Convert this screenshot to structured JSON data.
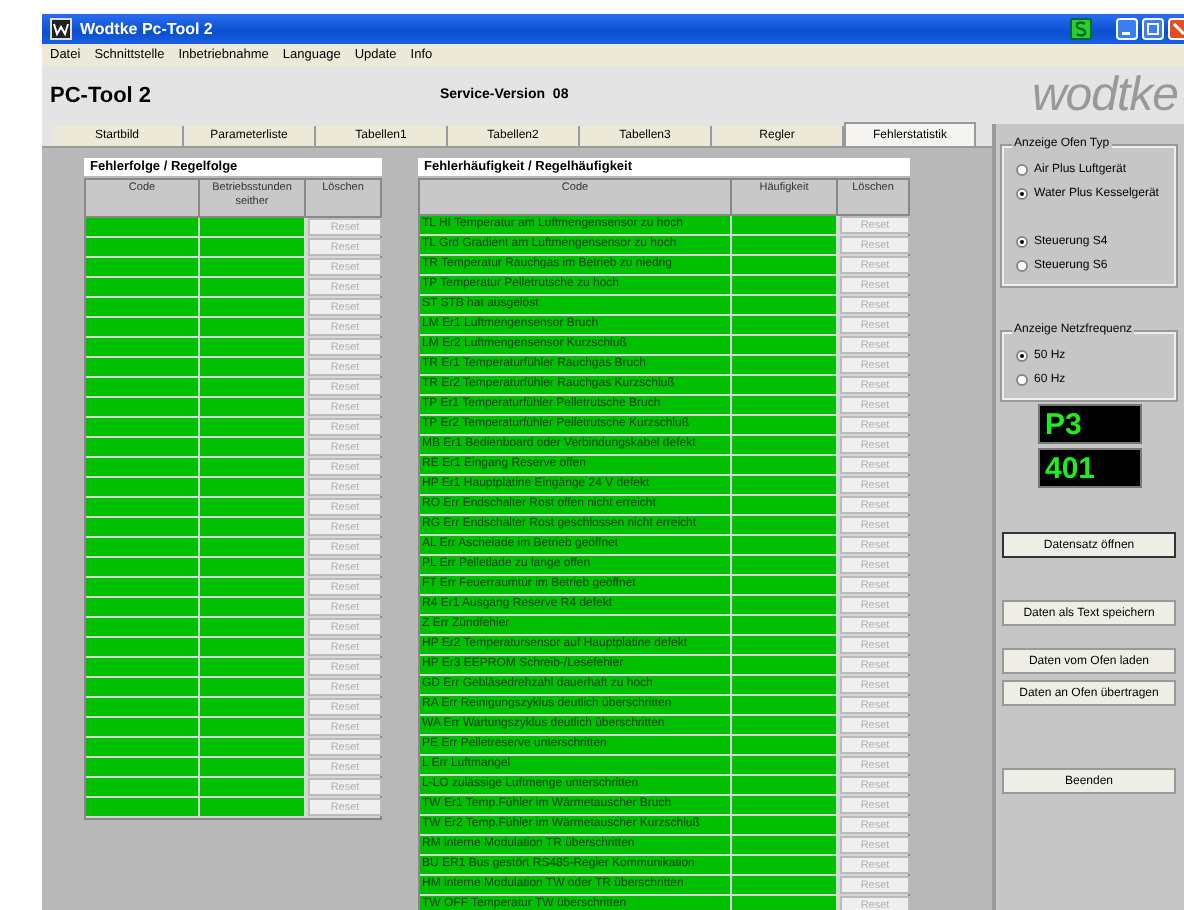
{
  "window": {
    "title": "Wodtke Pc-Tool 2"
  },
  "menu": [
    "Datei",
    "Schnittstelle",
    "Inbetriebnahme",
    "Language",
    "Update",
    "Info"
  ],
  "header": {
    "app_name": "PC-Tool 2",
    "version": "Service-Version  08",
    "logo": "wodtke"
  },
  "tabs": [
    {
      "label": "Startbild",
      "selected": false
    },
    {
      "label": "Parameterliste",
      "selected": false
    },
    {
      "label": "Tabellen1",
      "selected": false
    },
    {
      "label": "Tabellen2",
      "selected": false
    },
    {
      "label": "Tabellen3",
      "selected": false
    },
    {
      "label": "Regler",
      "selected": false
    },
    {
      "label": "Fehlerstatistik",
      "selected": true
    }
  ],
  "error_sequence": {
    "title": "Fehlerfolge / Regelfolge",
    "columns": [
      "Code",
      "Betriebsstunden seither",
      "Löschen"
    ],
    "rows": [
      {
        "reset": "Reset",
        "disabled": true
      },
      {
        "reset": "Reset",
        "disabled": true
      },
      {
        "reset": "Reset",
        "disabled": true
      },
      {
        "reset": "Reset",
        "disabled": true
      },
      {
        "reset": "Reset",
        "disabled": true
      },
      {
        "reset": "Reset",
        "disabled": true
      },
      {
        "reset": "Reset",
        "disabled": true
      },
      {
        "reset": "Reset",
        "disabled": true
      },
      {
        "reset": "Reset",
        "disabled": true
      },
      {
        "reset": "Reset",
        "disabled": true
      },
      {
        "reset": "Reset",
        "disabled": true
      },
      {
        "reset": "Reset",
        "disabled": true
      },
      {
        "reset": "Reset",
        "disabled": true
      },
      {
        "reset": "Reset",
        "disabled": true
      },
      {
        "reset": "Reset",
        "disabled": true
      },
      {
        "reset": "Reset",
        "disabled": true
      },
      {
        "reset": "Reset",
        "disabled": true
      },
      {
        "reset": "Reset",
        "disabled": true
      },
      {
        "reset": "Reset",
        "disabled": true
      },
      {
        "reset": "Reset",
        "disabled": true
      },
      {
        "reset": "Reset",
        "disabled": true
      },
      {
        "reset": "Reset",
        "disabled": true
      },
      {
        "reset": "Reset",
        "disabled": true
      },
      {
        "reset": "Reset",
        "disabled": true
      },
      {
        "reset": "Reset",
        "disabled": true
      },
      {
        "reset": "Reset",
        "disabled": true
      },
      {
        "reset": "Reset",
        "disabled": true
      },
      {
        "reset": "Reset",
        "disabled": true
      },
      {
        "reset": "Reset",
        "disabled": true
      },
      {
        "reset": "Reset",
        "disabled": true
      }
    ]
  },
  "error_frequency": {
    "title": "Fehlerhäufigkeit / Regelhäufigkeit",
    "columns": [
      "Code",
      "Häufigkeit",
      "Löschen"
    ],
    "rows": [
      {
        "code": "TL HI Temperatur am Luftmengensensor zu hoch",
        "reset": "Reset",
        "disabled": true
      },
      {
        "code": "TL Grd Gradient am Luftmengensensor zu hoch",
        "reset": "Reset",
        "disabled": true
      },
      {
        "code": "TR Temperatur Rauchgas im Betrieb zu niedrig",
        "reset": "Reset",
        "disabled": true
      },
      {
        "code": "TP Temperatur Pelletrutsche zu hoch",
        "reset": "Reset",
        "disabled": true
      },
      {
        "code": "ST STB hat ausgelöst",
        "reset": "Reset",
        "disabled": true
      },
      {
        "code": "LM Er1 Luftmengensensor Bruch",
        "reset": "Reset",
        "disabled": true
      },
      {
        "code": "LM Er2 Luftmengensensor Kurzschluß",
        "reset": "Reset",
        "disabled": true
      },
      {
        "code": "TR Er1 Temperaturfühler Rauchgas Bruch",
        "reset": "Reset",
        "disabled": true
      },
      {
        "code": "TR Er2 Temperaturfühler Rauchgas Kurzschluß",
        "reset": "Reset",
        "disabled": true
      },
      {
        "code": "TP Er1 Temperaturfühler Pelletrutsche Bruch",
        "reset": "Reset",
        "disabled": true
      },
      {
        "code": "TP Er2 Temperaturfühler Pelletrutsche Kurzschluß",
        "reset": "Reset",
        "disabled": true
      },
      {
        "code": "MB Er1 Bedienboard oder Verbindungskabel defekt",
        "reset": "Reset",
        "disabled": true
      },
      {
        "code": "RE Er1 Eingang Reserve offen",
        "reset": "Reset",
        "disabled": true
      },
      {
        "code": "HP Er1 Hauptplatine Eingänge 24 V defekt",
        "reset": "Reset",
        "disabled": true
      },
      {
        "code": "RO Err Endschalter Rost offen nicht erreicht",
        "reset": "Reset",
        "disabled": true
      },
      {
        "code": "RG Err Endschalter Rost geschlossen nicht erreicht",
        "reset": "Reset",
        "disabled": true
      },
      {
        "code": "AL Err Aschelade im Betrieb geöffnet",
        "reset": "Reset",
        "disabled": true
      },
      {
        "code": "PL Err Pelletlade zu lange offen",
        "reset": "Reset",
        "disabled": true
      },
      {
        "code": "FT Err Feuerraumtür im Betrieb geöffnet",
        "reset": "Reset",
        "disabled": true
      },
      {
        "code": "R4 Er1 Ausgang Reserve R4 defekt",
        "reset": "Reset",
        "disabled": true
      },
      {
        "code": "Z Err Zündfehler",
        "reset": "Reset",
        "disabled": true
      },
      {
        "code": "HP Er2 Temperatursensor auf Hauptplatine defekt",
        "reset": "Reset",
        "disabled": true
      },
      {
        "code": "HP Er3 EEPROM Schreib-/Lesefehler",
        "reset": "Reset",
        "disabled": true
      },
      {
        "code": "GD Err Gebläsedrehzahl dauerhaft zu hoch",
        "reset": "Reset",
        "disabled": true
      },
      {
        "code": "RA Err Reinigungszyklus deutlich überschritten",
        "reset": "Reset",
        "disabled": true
      },
      {
        "code": "WA Err Wartungszyklus deutlich überschritten",
        "reset": "Reset",
        "disabled": true
      },
      {
        "code": "PE Err Pelletreserve unterschritten",
        "reset": "Reset",
        "disabled": true
      },
      {
        "code": "L Err Luftmangel",
        "reset": "Reset",
        "disabled": true
      },
      {
        "code": "L-LO zulässige Luftmenge unterschritten",
        "reset": "Reset",
        "disabled": true
      },
      {
        "code": "TW Er1 Temp.Fühler im Wärmetauscher Bruch",
        "reset": "Reset",
        "disabled": true
      },
      {
        "code": "TW Er2 Temp.Fühler im Wärmetauscher Kurzschluß",
        "reset": "Reset",
        "disabled": true
      },
      {
        "code": "RM interne Modulation TR überschritten",
        "reset": "Reset",
        "disabled": true
      },
      {
        "code": "BU ER1 Bus gestört RS485-Regler Kommunikation",
        "reset": "Reset",
        "disabled": true
      },
      {
        "code": "HM interne Modulation TW oder TR überschritten",
        "reset": "Reset",
        "disabled": true
      },
      {
        "code": "TW OFF Temperatur TW überschritten",
        "reset": "Reset",
        "disabled": true
      }
    ]
  },
  "oven_type": {
    "title": "Anzeige Ofen Typ",
    "options": [
      {
        "label": "Air Plus Luftgerät",
        "selected": false
      },
      {
        "label": "Water Plus Kesselgerät",
        "selected": true
      }
    ],
    "controls": [
      {
        "label": "Steuerung S4",
        "selected": true
      },
      {
        "label": "Steuerung S6",
        "selected": false
      }
    ]
  },
  "mains_frequency": {
    "title": "Anzeige Netzfrequenz",
    "options": [
      {
        "label": "50 Hz",
        "selected": true
      },
      {
        "label": "60 Hz",
        "selected": false
      }
    ]
  },
  "displays": [
    "P3",
    "401"
  ],
  "buttons": [
    {
      "label": "Datensatz öffnen",
      "focused": true
    },
    {
      "label": "Daten als Text speichern",
      "focused": false
    },
    {
      "label": "Daten vom Ofen laden",
      "focused": false
    },
    {
      "label": "Daten an Ofen übertragen",
      "focused": false
    },
    {
      "label": "Beenden",
      "focused": false
    }
  ]
}
